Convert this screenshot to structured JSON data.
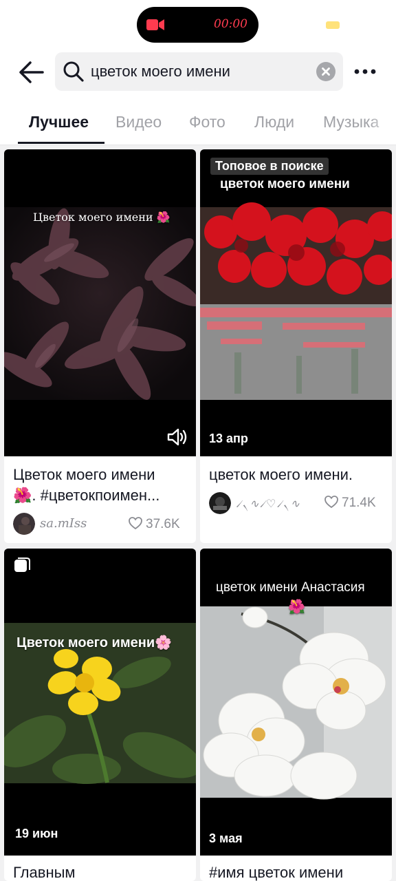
{
  "status": {
    "recording_time": "00:00",
    "recording_color": "#ff3b4f"
  },
  "header": {
    "back_icon": "arrow-left-icon",
    "search_icon": "search-icon",
    "search_value": "цветок моего имени",
    "clear_icon": "close-circle-icon",
    "more_icon": "more-dots-icon"
  },
  "tabs": [
    {
      "label": "Лучшее",
      "active": true
    },
    {
      "label": "Видео",
      "active": false
    },
    {
      "label": "Фото",
      "active": false
    },
    {
      "label": "Люди",
      "active": false
    },
    {
      "label": "Музыка",
      "active": false
    }
  ],
  "results": [
    {
      "overlay": "Цветок моего имени 🌺",
      "sound_icon": "speaker-icon",
      "title_line1": "Цветок моего имени",
      "title_line2": "🌺. #цветокпоимен...",
      "author": "sa.mIss",
      "likes": "37.6K"
    },
    {
      "badge": "Топовое в поиске",
      "overlay": "цветок моего имени",
      "date": "13 апр",
      "title_line1": "цветок моего имени.",
      "author": "৴৲∿৴♡৴৲∿",
      "likes": "71.4K"
    },
    {
      "carousel_icon": "photo-carousel-icon",
      "overlay": "Цветок моего имени🌸",
      "date": "19 июн",
      "title_line1": "Главным"
    },
    {
      "overlay": "цветок имени Анастасия",
      "overlay_emoji": "🌺",
      "date": "3 мая",
      "title_line1": "#имя цветок имени"
    }
  ],
  "colors": {
    "background": "#ffffff",
    "grid_background": "#f1f1f2",
    "text_primary": "#161823",
    "text_secondary": "#8a8b91",
    "tab_inactive": "#a1a2a7"
  }
}
